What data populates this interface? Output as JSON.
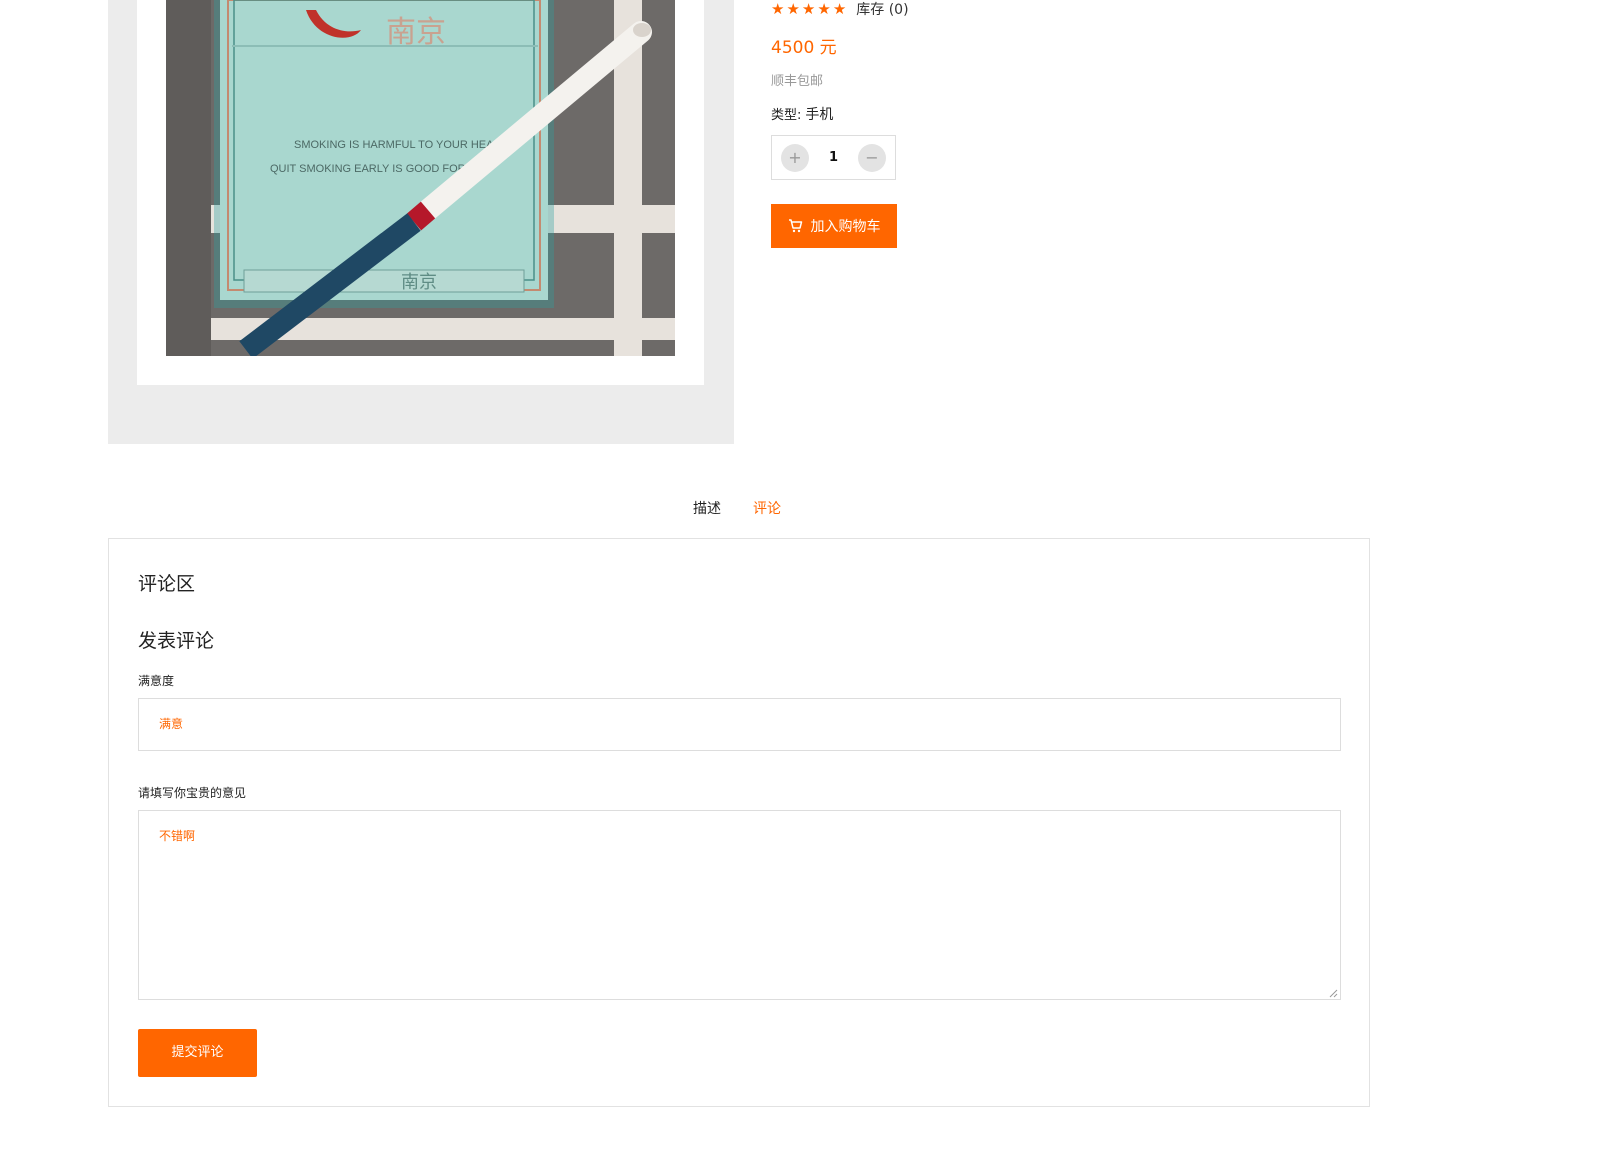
{
  "product": {
    "rating_stars": 5,
    "stock_label": "库存",
    "stock_count": "(0)",
    "price": "4500 元",
    "shipping": "顺丰包邮",
    "type_label": "类型:",
    "type_value": "手机",
    "quantity": "1",
    "qty_increase_symbol": "+",
    "qty_decrease_symbol": "−",
    "add_to_cart_label": "加入购物车",
    "image_text": {
      "brand": "南京",
      "warning_line1": "SMOKING IS HARMFUL TO YOUR HEALTH",
      "warning_line2": "QUIT SMOKING EARLY IS GOOD FOR YOU",
      "box_bottom": "南京"
    }
  },
  "tabs": {
    "description": "描述",
    "reviews": "评论"
  },
  "reviews": {
    "section_title": "评论区",
    "form_title": "发表评论",
    "satisfaction_label": "满意度",
    "satisfaction_value": "满意",
    "opinion_label": "请填写你宝贵的意见",
    "opinion_value": "不错啊",
    "submit_label": "提交评论"
  },
  "colors": {
    "accent": "#ff6600",
    "gallery_bg": "#ececec",
    "border": "#dddddd"
  },
  "icons": {
    "star": "star-icon",
    "cart": "cart-icon"
  }
}
